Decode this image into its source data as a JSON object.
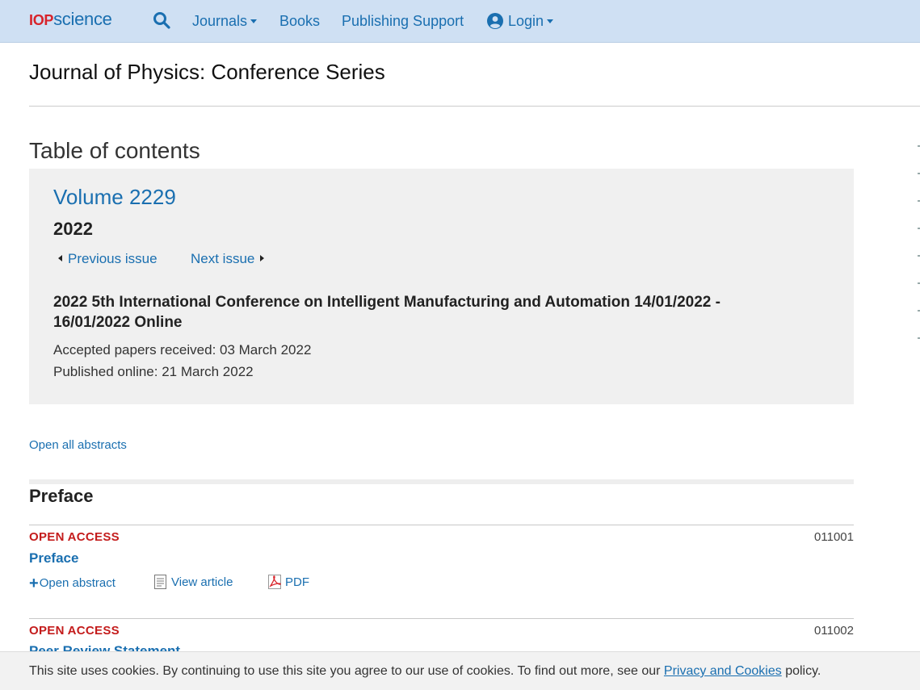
{
  "header": {
    "logo": {
      "iop": "IOP",
      "science": "science"
    },
    "nav": {
      "journals": "Journals",
      "books": "Books",
      "publishing_support": "Publishing Support",
      "login": "Login"
    },
    "icons": {
      "search": "search-icon",
      "user": "user-circle-icon"
    },
    "colors": {
      "bar": "#cfe0f3",
      "link": "#1a6fb0",
      "logo_red": "#d8232a"
    }
  },
  "journal_title": "Journal of Physics: Conference Series",
  "toc_heading": "Table of contents",
  "volume": {
    "title": "Volume 2229",
    "year": "2022",
    "previous_issue": "Previous issue",
    "next_issue": "Next issue",
    "conference": "2022 5th International Conference on Intelligent Manufacturing and Automation 14/01/2022 - 16/01/2022 Online",
    "accepted": "Accepted papers received: 03 March 2022",
    "published": "Published online: 21 March 2022"
  },
  "open_all_abstracts": "Open all abstracts",
  "section": {
    "title": "Preface"
  },
  "articles": [
    {
      "access": "OPEN ACCESS",
      "number": "011001",
      "title": "Preface",
      "actions": {
        "open_abstract": "Open abstract",
        "view_article": "View article",
        "pdf": "PDF"
      }
    },
    {
      "access": "OPEN ACCESS",
      "number": "011002",
      "title": "Peer Review Statement"
    }
  ],
  "cookie_banner": {
    "text_before": "This site uses cookies. By continuing to use this site you agree to our use of cookies. To find out more, see our ",
    "link": "Privacy and Cookies",
    "text_after": " policy."
  }
}
